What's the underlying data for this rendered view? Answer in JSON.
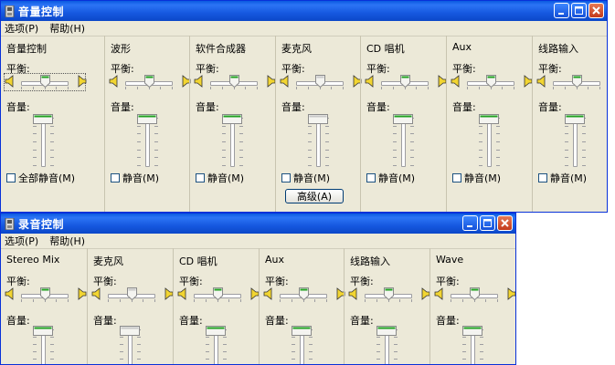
{
  "volume_window": {
    "title": "音量控制",
    "menu": [
      "选项(P)",
      "帮助(H)"
    ],
    "channels": [
      {
        "name": "音量控制",
        "balance_label": "平衡:",
        "volume_label": "音量:",
        "mute_label": "全部静音(M)",
        "balance": 0.5,
        "volume": 1.0,
        "muted": false,
        "focused": true
      },
      {
        "name": "波形",
        "balance_label": "平衡:",
        "volume_label": "音量:",
        "mute_label": "静音(M)",
        "balance": 0.5,
        "volume": 1.0,
        "muted": false
      },
      {
        "name": "软件合成器",
        "balance_label": "平衡:",
        "volume_label": "音量:",
        "mute_label": "静音(M)",
        "balance": 0.5,
        "volume": 1.0,
        "muted": false
      },
      {
        "name": "麦克风",
        "balance_label": "平衡:",
        "volume_label": "音量:",
        "mute_label": "静音(M)",
        "balance": 0.5,
        "volume": 1.0,
        "muted": false,
        "dimmed": true,
        "advanced_label": "高级(A)"
      },
      {
        "name": "CD 唱机",
        "balance_label": "平衡:",
        "volume_label": "音量:",
        "mute_label": "静音(M)",
        "balance": 0.5,
        "volume": 1.0,
        "muted": false
      },
      {
        "name": "Aux",
        "balance_label": "平衡:",
        "volume_label": "音量:",
        "mute_label": "静音(M)",
        "balance": 0.5,
        "volume": 1.0,
        "muted": false
      },
      {
        "name": "线路输入",
        "balance_label": "平衡:",
        "volume_label": "音量:",
        "mute_label": "静音(M)",
        "balance": 0.5,
        "volume": 1.0,
        "muted": false
      }
    ]
  },
  "record_window": {
    "title": "录音控制",
    "menu": [
      "选项(P)",
      "帮助(H)"
    ],
    "channels": [
      {
        "name": "Stereo Mix",
        "balance_label": "平衡:",
        "volume_label": "音量:",
        "balance": 0.5,
        "volume": 1.0
      },
      {
        "name": "麦克风",
        "balance_label": "平衡:",
        "volume_label": "音量:",
        "balance": 0.5,
        "volume": 1.0,
        "dimmed": true
      },
      {
        "name": "CD 唱机",
        "balance_label": "平衡:",
        "volume_label": "音量:",
        "balance": 0.5,
        "volume": 1.0
      },
      {
        "name": "Aux",
        "balance_label": "平衡:",
        "volume_label": "音量:",
        "balance": 0.5,
        "volume": 1.0
      },
      {
        "name": "线路输入",
        "balance_label": "平衡:",
        "volume_label": "音量:",
        "balance": 0.5,
        "volume": 1.0
      },
      {
        "name": "Wave",
        "balance_label": "平衡:",
        "volume_label": "音量:",
        "balance": 0.5,
        "volume": 1.0
      }
    ]
  },
  "colors": {
    "titlebar": "#0a5ae0",
    "face": "#ece9d8",
    "thumb_green": "#21a121"
  }
}
